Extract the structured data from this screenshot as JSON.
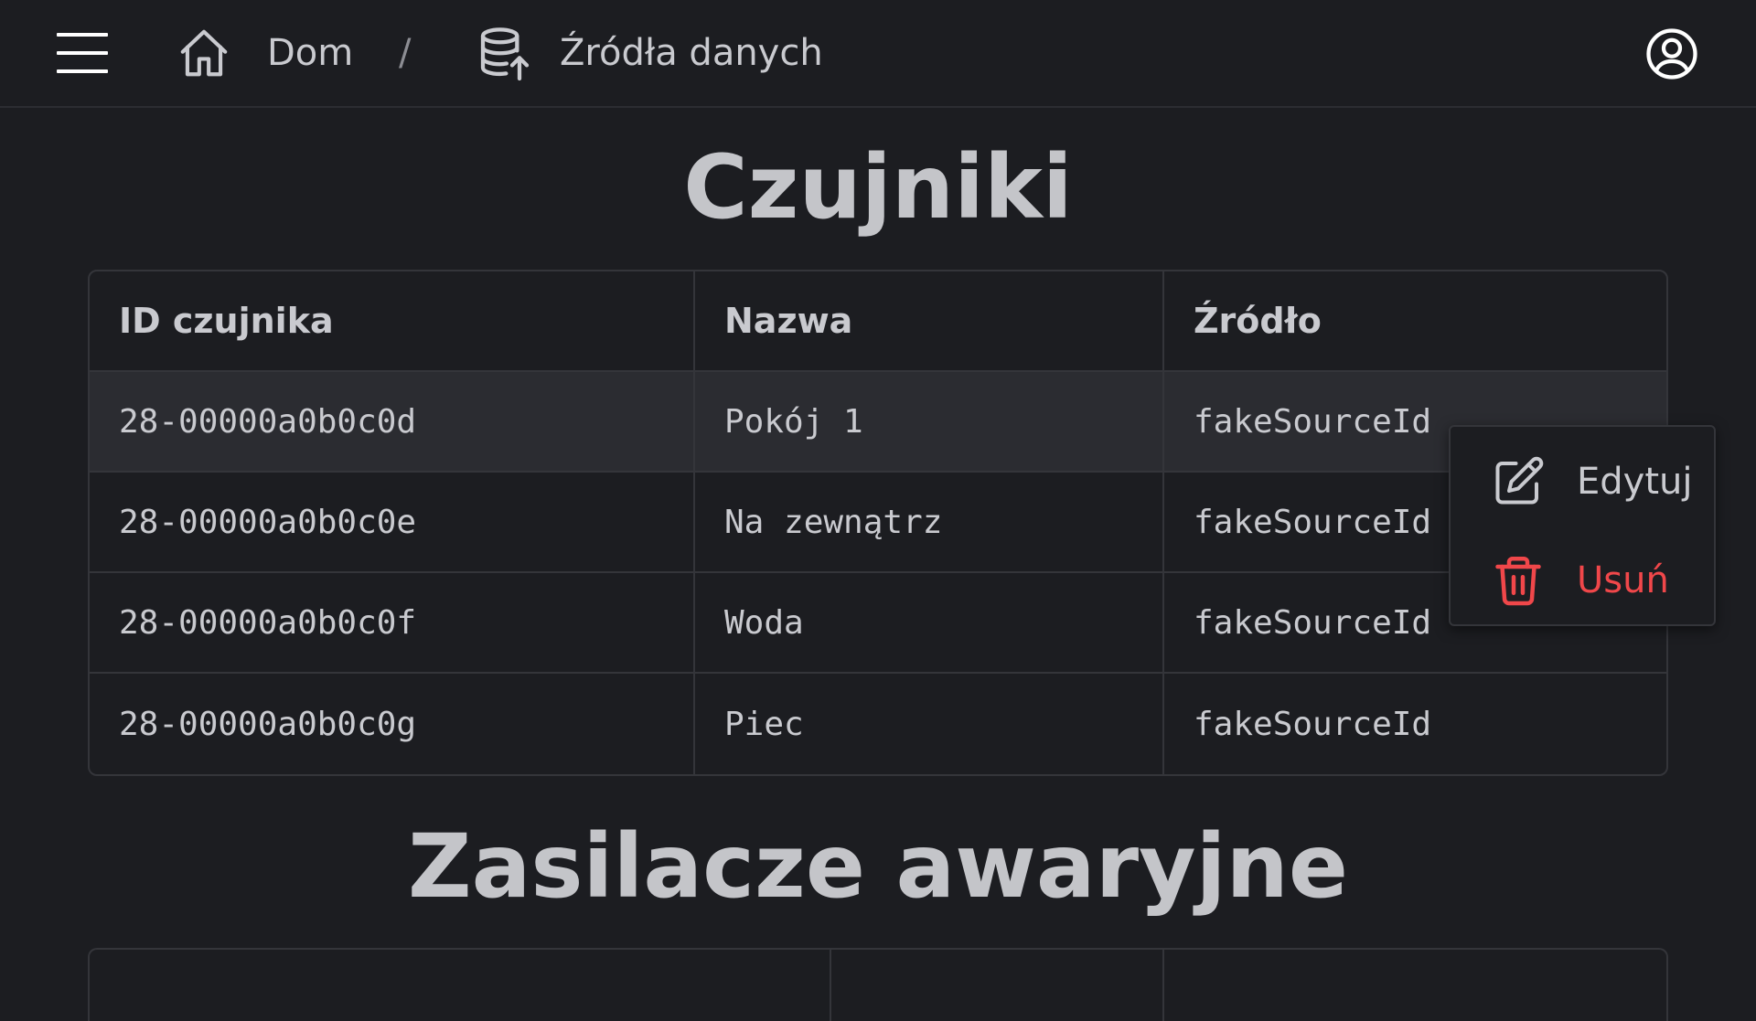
{
  "header": {
    "breadcrumb": {
      "home_label": "Dom",
      "separator": "/",
      "current_label": "Źródła danych"
    },
    "icons": {
      "menu": "hamburger-menu-icon",
      "home": "home-icon",
      "current": "database-upload-icon",
      "user": "user-account-icon"
    }
  },
  "sensors": {
    "title": "Czujniki",
    "columns": [
      "ID czujnika",
      "Nazwa",
      "Źródło"
    ],
    "rows": [
      {
        "id": "28-00000a0b0c0d",
        "name": "Pokój 1",
        "source": "fakeSourceId"
      },
      {
        "id": "28-00000a0b0c0e",
        "name": "Na zewnątrz",
        "source": "fakeSourceId"
      },
      {
        "id": "28-00000a0b0c0f",
        "name": "Woda",
        "source": "fakeSourceId"
      },
      {
        "id": "28-00000a0b0c0g",
        "name": "Piec",
        "source": "fakeSourceId"
      }
    ]
  },
  "ups": {
    "title": "Zasilacze awaryjne",
    "columns": [
      "",
      "",
      ""
    ]
  },
  "context_menu": {
    "edit_label": "Edytuj",
    "delete_label": "Usuń",
    "delete_color": "#f0474a"
  }
}
